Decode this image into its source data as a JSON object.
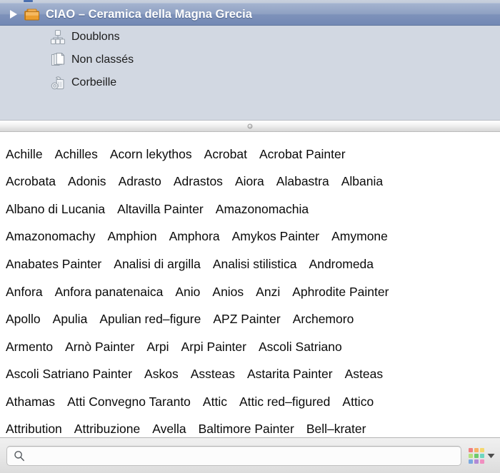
{
  "window": {
    "title": "CIAO – Ceramica della Magna Grecia"
  },
  "source_pane": {
    "root": {
      "label": "CIAO – Ceramica della Magna Grecia",
      "icon": "folder-icon",
      "selected": true,
      "expanded": false,
      "disclosure_icon": "disclosure-triangle-right-icon"
    },
    "children": [
      {
        "label": "Doublons",
        "icon": "duplicates-icon"
      },
      {
        "label": "Non classés",
        "icon": "unfiled-documents-icon"
      },
      {
        "label": "Corbeille",
        "icon": "trash-icon"
      }
    ]
  },
  "splitter": {
    "handle_icon": "splitter-dot-handle-icon"
  },
  "tag_cloud": {
    "rows": [
      [
        "Achille",
        "Achilles",
        "Acorn lekythos",
        "Acrobat",
        "Acrobat Painter"
      ],
      [
        "Acrobata",
        "Adonis",
        "Adrasto",
        "Adrastos",
        "Aiora",
        "Alabastra",
        "Albania"
      ],
      [
        "Albano di Lucania",
        "Altavilla Painter",
        "Amazonomachia"
      ],
      [
        "Amazonomachy",
        "Amphion",
        "Amphora",
        "Amykos Painter",
        "Amymone"
      ],
      [
        "Anabates Painter",
        "Analisi di argilla",
        "Analisi stilistica",
        "Andromeda"
      ],
      [
        "Anfora",
        "Anfora panatenaica",
        "Anio",
        "Anios",
        "Anzi",
        "Aphrodite Painter"
      ],
      [
        "Apollo",
        "Apulia",
        "Apulian red–figure",
        "APZ Painter",
        "Archemoro"
      ],
      [
        "Armento",
        "Arnò Painter",
        "Arpi",
        "Arpi Painter",
        "Ascoli Satriano"
      ],
      [
        "Ascoli Satriano Painter",
        "Askos",
        "Assteas",
        "Astarita Painter",
        "Asteas"
      ],
      [
        "Athamas",
        "Atti Convegno Taranto",
        "Attic",
        "Attic red–figured",
        "Attico"
      ],
      [
        "Attribution",
        "Attribuzione",
        "Avella",
        "Baltimore Painter",
        "Bell–krater"
      ]
    ]
  },
  "bottom_bar": {
    "search": {
      "icon": "search-icon",
      "value": "",
      "placeholder": ""
    },
    "color_picker": {
      "icon": "color-grid-icon",
      "arrow_icon": "chevron-down-icon",
      "swatches": [
        "#f08080",
        "#f7b267",
        "#f5d76e",
        "#b5e07f",
        "#6ec96e",
        "#6fd6c0",
        "#7aa8e0",
        "#b08ad6",
        "#f08fc0"
      ]
    }
  },
  "colors": {
    "selection_blue": "#7e92ba",
    "source_pane_bg": "#d2d8e2",
    "folder_orange": "#e2952a",
    "tag_text": "#0a0a0a",
    "toolbar_bg": "#e6e6e6"
  }
}
